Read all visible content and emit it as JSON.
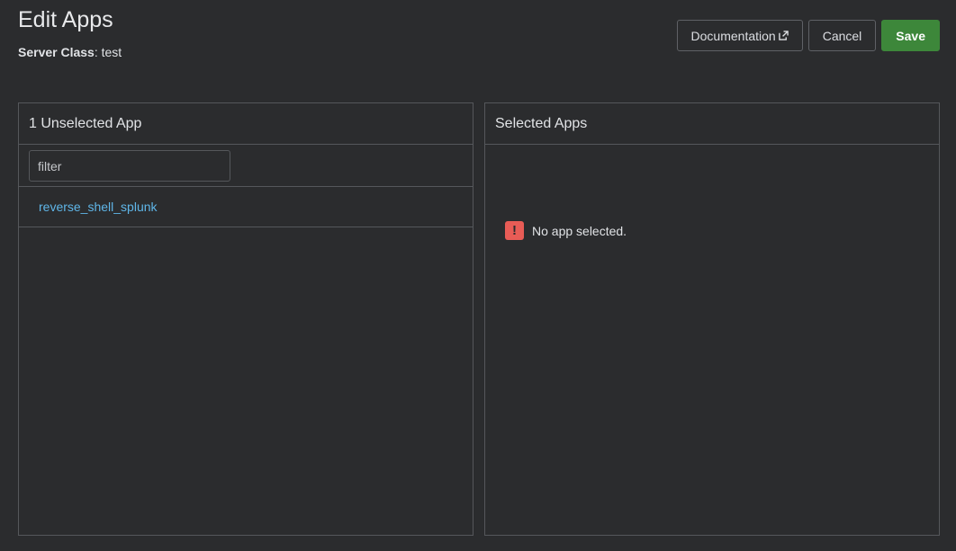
{
  "header": {
    "title": "Edit Apps",
    "server_class_label": "Server Class",
    "server_class_value": "test"
  },
  "actions": {
    "documentation_label": "Documentation",
    "cancel_label": "Cancel",
    "save_label": "Save"
  },
  "unselected_panel": {
    "title": "1 Unselected App",
    "filter_placeholder": "filter",
    "filter_value": "",
    "items": [
      {
        "label": "reverse_shell_splunk"
      }
    ]
  },
  "selected_panel": {
    "title": "Selected Apps",
    "empty_message": "No app selected."
  },
  "colors": {
    "background": "#2b2c2e",
    "border": "#55575b",
    "primary": "#3d873a",
    "link": "#5fb6e8",
    "warning": "#e85c56"
  },
  "icons": {
    "documentation": "external-link-icon",
    "empty": "exclamation-icon"
  }
}
